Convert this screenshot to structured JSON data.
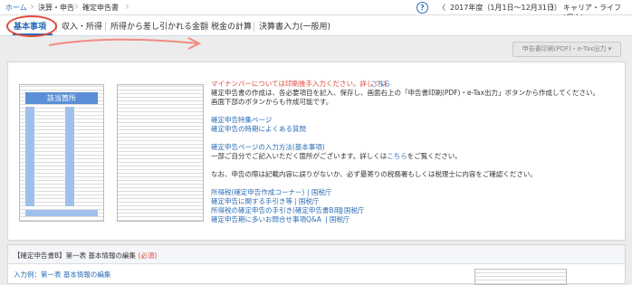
{
  "breadcrumb": [
    "ホーム",
    "決算・申告",
    "確定申告書"
  ],
  "header": {
    "help_label": "?",
    "year_prev": "〈",
    "year_label": "2017年度（1月1日〜12月31日）",
    "year_next": "〉",
    "user_label": "キャリア・ライフ (個人)▾"
  },
  "tabs": [
    {
      "label": "基本事項",
      "active": true
    },
    {
      "label": "収入・所得",
      "active": false
    },
    {
      "label": "所得から差し引かれる金額",
      "active": false
    },
    {
      "label": "税金の計算",
      "active": false
    },
    {
      "label": "決算書入力(一般用)",
      "active": false
    }
  ],
  "toolbar": {
    "print_label": "申告書印刷(PDF)・e-Tax出力 ▾"
  },
  "form_preview": {
    "header": "該当箇所"
  },
  "info": {
    "mynumber_notice": "マイナンバーについては印刷後手入力ください。詳しくは",
    "mynumber_link": "こちら",
    "desc1": "確定申告書の作成は、各必要項目を記入、保存し、画面右上の「申告書印刷(PDF)・e-Tax出力」ボタンから作成してください。",
    "desc2": "画面下部のボタンからも作成可能です。",
    "link_special": "確定申告特集ページ",
    "link_faq": "確定申告の時期によくある質問",
    "link_howto": "確定申告ページの入力方法(基本事項)",
    "howto_desc_pre": "一部ご自分でご記入いただく箇所がございます。詳しくは",
    "howto_desc_link": "こちら",
    "howto_desc_post": "をご覧ください。",
    "note": "なお、申告の際は記載内容に誤りがないか、必ず最寄りの税務署もしくは税理士に内容をご確認ください。",
    "links": [
      {
        "label": "所得税(確定申告作成コーナー)",
        "suffix": "| 国税庁"
      },
      {
        "label": "確定申告に関する手引き等",
        "suffix": "| 国税庁"
      },
      {
        "label": "所得税の確定申告の手引き(確定申告書B用)",
        "suffix": "| 国税庁"
      },
      {
        "label": "確定申告期に多いお問合せ事項Q&A",
        "suffix": "| 国税庁"
      }
    ]
  },
  "section": {
    "title": "【確定申告書B】第一表 基本情報の編集",
    "required": "(必須)",
    "example_link": "入力例：第一表 基本情報の編集"
  }
}
